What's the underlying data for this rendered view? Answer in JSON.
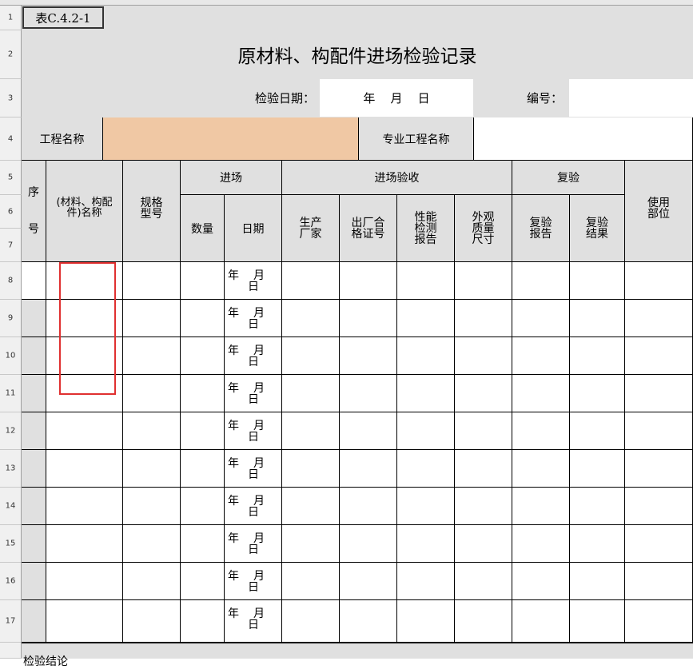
{
  "table_tag": "表C.4.2-1",
  "row_numbers": [
    "1",
    "2",
    "3",
    "4",
    "5",
    "6",
    "7",
    "8",
    "9",
    "10",
    "11",
    "12",
    "13",
    "14",
    "15",
    "16",
    "17"
  ],
  "form": {
    "title": "原材料、构配件进场检验记录",
    "inspection_date_label": "检验日期：",
    "date_placeholder": "年    月    日",
    "number_label": "编号：",
    "project_name_label": "工程名称",
    "specialty_label": "专业工程名称"
  },
  "headers": {
    "seq": "序号",
    "material_name": "(材料、构配件)名称",
    "spec_model": "规格型号",
    "entry": "进场",
    "quantity": "数量",
    "date": "日期",
    "entry_inspection": "进场验收",
    "manufacturer": "生产厂家",
    "certificate": "出厂合格证号",
    "performance_report": "性能检测报告",
    "appearance": "外观质量尺寸",
    "reinspection": "复验",
    "reinspection_report": "复验报告",
    "reinspection_result": "复验结果",
    "usage_location": "使用部位"
  },
  "date_cell": {
    "year": "年",
    "month": "月",
    "day": "日"
  },
  "footer_label": "检验结论"
}
